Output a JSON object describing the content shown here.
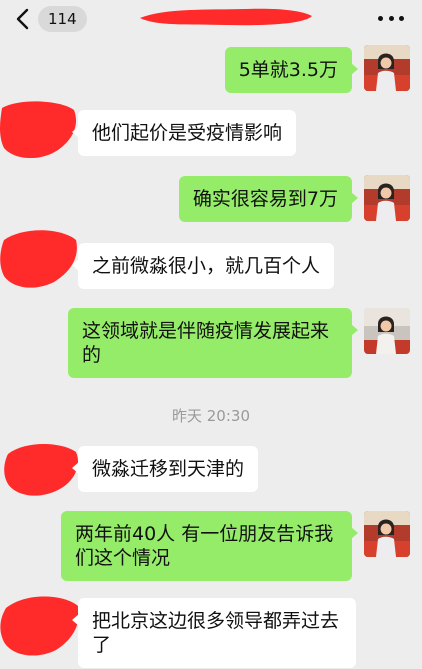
{
  "header": {
    "unread_count": "114",
    "back_icon": "chevron-left-icon",
    "more_icon": "more-dots-icon"
  },
  "colors": {
    "background": "#ededed",
    "my_bubble": "#95ec69",
    "their_bubble": "#ffffff",
    "redaction": "#ff2a2a"
  },
  "timestamp": "昨天 20:30",
  "messages": [
    {
      "sender": "me",
      "text": "5单就3.5万"
    },
    {
      "sender": "other",
      "text": "他们起价是受疫情影响"
    },
    {
      "sender": "me",
      "text": "确实很容易到7万"
    },
    {
      "sender": "other",
      "text": "之前微淼很小，就几百个人"
    },
    {
      "sender": "me",
      "text": "这领域就是伴随疫情发展起来的"
    },
    {
      "sender": "other",
      "text": "微淼迁移到天津的"
    },
    {
      "sender": "me",
      "text": "两年前40人 有一位朋友告诉我们这个情况"
    },
    {
      "sender": "other",
      "text": "把北京这边很多领导都弄过去了"
    }
  ]
}
